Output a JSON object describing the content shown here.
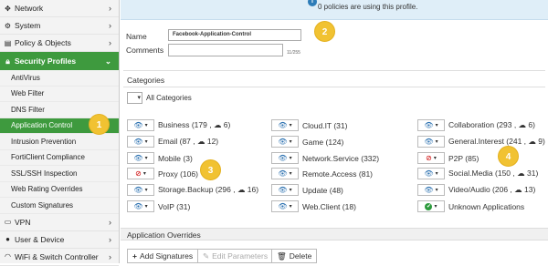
{
  "sidebar": {
    "top": [
      {
        "label": "Network",
        "icon": "network-icon"
      },
      {
        "label": "System",
        "icon": "gear-icon"
      },
      {
        "label": "Policy & Objects",
        "icon": "document-icon"
      }
    ],
    "section": {
      "label": "Security Profiles",
      "icon": "lock-icon"
    },
    "sub": [
      "AntiVirus",
      "Web Filter",
      "DNS Filter",
      "Application Control",
      "Intrusion Prevention",
      "FortiClient Compliance",
      "SSL/SSH Inspection",
      "Web Rating Overrides",
      "Custom Signatures"
    ],
    "bottom": [
      {
        "label": "VPN",
        "icon": "monitor-icon"
      },
      {
        "label": "User & Device",
        "icon": "user-icon"
      },
      {
        "label": "WiFi & Switch Controller",
        "icon": "wifi-icon"
      }
    ]
  },
  "banner": {
    "text": "0 policies are using this profile."
  },
  "form": {
    "name_label": "Name",
    "name_value": "Facebook-Application-Control",
    "comments_label": "Comments",
    "comments_value": "",
    "counter": "11/255"
  },
  "categories": {
    "header": "Categories",
    "all_label": "All Categories",
    "items": [
      {
        "label": "Business (179 , ☁ 6)",
        "action": "monitor"
      },
      {
        "label": "Cloud.IT (31)",
        "action": "monitor"
      },
      {
        "label": "Collaboration (293 , ☁ 6)",
        "action": "monitor"
      },
      {
        "label": "Email (87 , ☁ 12)",
        "action": "monitor"
      },
      {
        "label": "Game (124)",
        "action": "monitor"
      },
      {
        "label": "General.Interest (241 , ☁ 9)",
        "action": "monitor"
      },
      {
        "label": "Mobile (3)",
        "action": "monitor"
      },
      {
        "label": "Network.Service (332)",
        "action": "monitor"
      },
      {
        "label": "P2P (85)",
        "action": "block"
      },
      {
        "label": "Proxy (106)",
        "action": "block"
      },
      {
        "label": "Remote.Access (81)",
        "action": "monitor"
      },
      {
        "label": "Social.Media (150 , ☁ 31)",
        "action": "monitor"
      },
      {
        "label": "Storage.Backup (296 , ☁ 16)",
        "action": "monitor"
      },
      {
        "label": "Update (48)",
        "action": "monitor"
      },
      {
        "label": "Video/Audio (206 , ☁ 13)",
        "action": "monitor"
      },
      {
        "label": "VoIP (31)",
        "action": "monitor"
      },
      {
        "label": "Web.Client (18)",
        "action": "monitor"
      },
      {
        "label": "Unknown Applications",
        "action": "allow"
      }
    ]
  },
  "overrides": {
    "header": "Application Overrides",
    "add_label": "Add Signatures",
    "edit_label": "Edit Parameters",
    "delete_label": "Delete"
  },
  "badges": [
    "1",
    "2",
    "3",
    "4"
  ],
  "colors": {
    "accent": "#3e9a3e",
    "badge": "#f1c232",
    "info": "#2d7cb8",
    "block": "#cc0000"
  }
}
